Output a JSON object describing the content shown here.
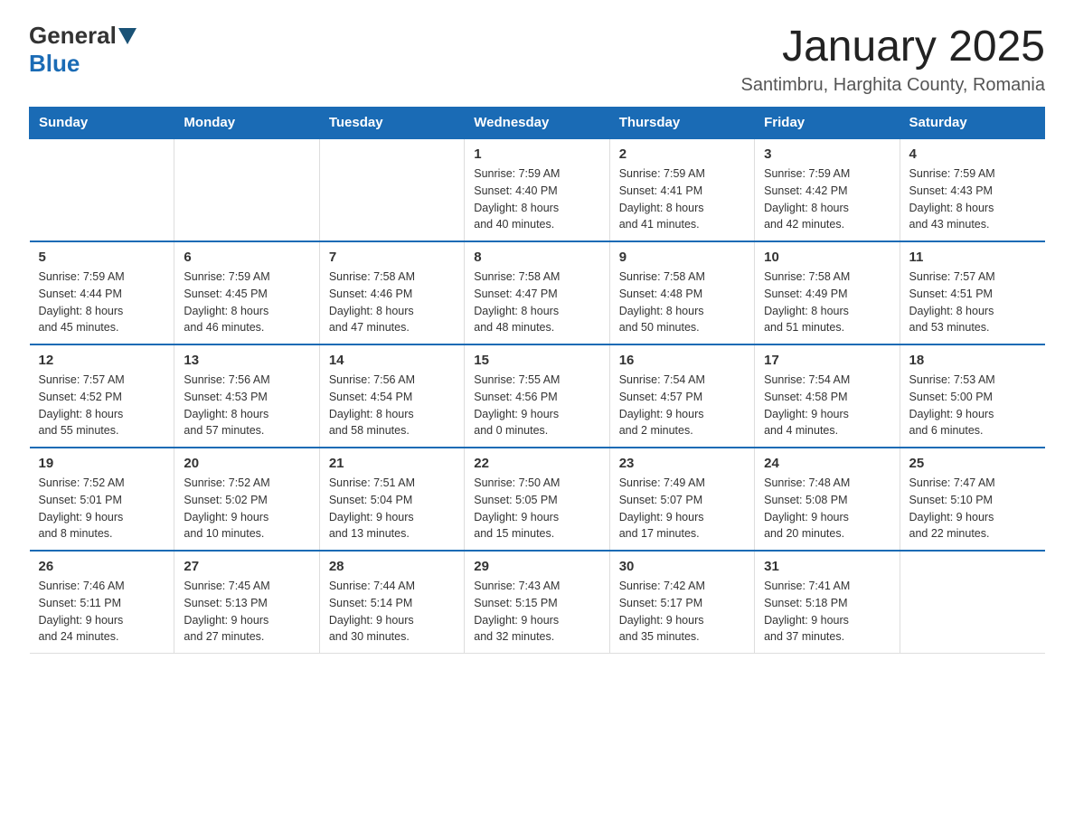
{
  "logo": {
    "general": "General",
    "blue": "Blue"
  },
  "title": "January 2025",
  "subtitle": "Santimbru, Harghita County, Romania",
  "days_of_week": [
    "Sunday",
    "Monday",
    "Tuesday",
    "Wednesday",
    "Thursday",
    "Friday",
    "Saturday"
  ],
  "weeks": [
    [
      {
        "day": "",
        "info": ""
      },
      {
        "day": "",
        "info": ""
      },
      {
        "day": "",
        "info": ""
      },
      {
        "day": "1",
        "info": "Sunrise: 7:59 AM\nSunset: 4:40 PM\nDaylight: 8 hours\nand 40 minutes."
      },
      {
        "day": "2",
        "info": "Sunrise: 7:59 AM\nSunset: 4:41 PM\nDaylight: 8 hours\nand 41 minutes."
      },
      {
        "day": "3",
        "info": "Sunrise: 7:59 AM\nSunset: 4:42 PM\nDaylight: 8 hours\nand 42 minutes."
      },
      {
        "day": "4",
        "info": "Sunrise: 7:59 AM\nSunset: 4:43 PM\nDaylight: 8 hours\nand 43 minutes."
      }
    ],
    [
      {
        "day": "5",
        "info": "Sunrise: 7:59 AM\nSunset: 4:44 PM\nDaylight: 8 hours\nand 45 minutes."
      },
      {
        "day": "6",
        "info": "Sunrise: 7:59 AM\nSunset: 4:45 PM\nDaylight: 8 hours\nand 46 minutes."
      },
      {
        "day": "7",
        "info": "Sunrise: 7:58 AM\nSunset: 4:46 PM\nDaylight: 8 hours\nand 47 minutes."
      },
      {
        "day": "8",
        "info": "Sunrise: 7:58 AM\nSunset: 4:47 PM\nDaylight: 8 hours\nand 48 minutes."
      },
      {
        "day": "9",
        "info": "Sunrise: 7:58 AM\nSunset: 4:48 PM\nDaylight: 8 hours\nand 50 minutes."
      },
      {
        "day": "10",
        "info": "Sunrise: 7:58 AM\nSunset: 4:49 PM\nDaylight: 8 hours\nand 51 minutes."
      },
      {
        "day": "11",
        "info": "Sunrise: 7:57 AM\nSunset: 4:51 PM\nDaylight: 8 hours\nand 53 minutes."
      }
    ],
    [
      {
        "day": "12",
        "info": "Sunrise: 7:57 AM\nSunset: 4:52 PM\nDaylight: 8 hours\nand 55 minutes."
      },
      {
        "day": "13",
        "info": "Sunrise: 7:56 AM\nSunset: 4:53 PM\nDaylight: 8 hours\nand 57 minutes."
      },
      {
        "day": "14",
        "info": "Sunrise: 7:56 AM\nSunset: 4:54 PM\nDaylight: 8 hours\nand 58 minutes."
      },
      {
        "day": "15",
        "info": "Sunrise: 7:55 AM\nSunset: 4:56 PM\nDaylight: 9 hours\nand 0 minutes."
      },
      {
        "day": "16",
        "info": "Sunrise: 7:54 AM\nSunset: 4:57 PM\nDaylight: 9 hours\nand 2 minutes."
      },
      {
        "day": "17",
        "info": "Sunrise: 7:54 AM\nSunset: 4:58 PM\nDaylight: 9 hours\nand 4 minutes."
      },
      {
        "day": "18",
        "info": "Sunrise: 7:53 AM\nSunset: 5:00 PM\nDaylight: 9 hours\nand 6 minutes."
      }
    ],
    [
      {
        "day": "19",
        "info": "Sunrise: 7:52 AM\nSunset: 5:01 PM\nDaylight: 9 hours\nand 8 minutes."
      },
      {
        "day": "20",
        "info": "Sunrise: 7:52 AM\nSunset: 5:02 PM\nDaylight: 9 hours\nand 10 minutes."
      },
      {
        "day": "21",
        "info": "Sunrise: 7:51 AM\nSunset: 5:04 PM\nDaylight: 9 hours\nand 13 minutes."
      },
      {
        "day": "22",
        "info": "Sunrise: 7:50 AM\nSunset: 5:05 PM\nDaylight: 9 hours\nand 15 minutes."
      },
      {
        "day": "23",
        "info": "Sunrise: 7:49 AM\nSunset: 5:07 PM\nDaylight: 9 hours\nand 17 minutes."
      },
      {
        "day": "24",
        "info": "Sunrise: 7:48 AM\nSunset: 5:08 PM\nDaylight: 9 hours\nand 20 minutes."
      },
      {
        "day": "25",
        "info": "Sunrise: 7:47 AM\nSunset: 5:10 PM\nDaylight: 9 hours\nand 22 minutes."
      }
    ],
    [
      {
        "day": "26",
        "info": "Sunrise: 7:46 AM\nSunset: 5:11 PM\nDaylight: 9 hours\nand 24 minutes."
      },
      {
        "day": "27",
        "info": "Sunrise: 7:45 AM\nSunset: 5:13 PM\nDaylight: 9 hours\nand 27 minutes."
      },
      {
        "day": "28",
        "info": "Sunrise: 7:44 AM\nSunset: 5:14 PM\nDaylight: 9 hours\nand 30 minutes."
      },
      {
        "day": "29",
        "info": "Sunrise: 7:43 AM\nSunset: 5:15 PM\nDaylight: 9 hours\nand 32 minutes."
      },
      {
        "day": "30",
        "info": "Sunrise: 7:42 AM\nSunset: 5:17 PM\nDaylight: 9 hours\nand 35 minutes."
      },
      {
        "day": "31",
        "info": "Sunrise: 7:41 AM\nSunset: 5:18 PM\nDaylight: 9 hours\nand 37 minutes."
      },
      {
        "day": "",
        "info": ""
      }
    ]
  ]
}
